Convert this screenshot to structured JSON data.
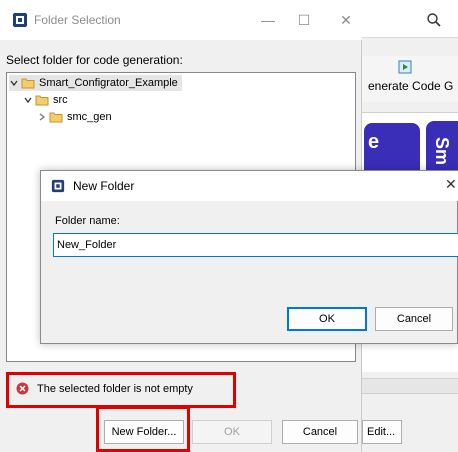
{
  "background_window": {
    "toolbar_label": "enerate Code  G",
    "block1_label": "e",
    "block2_label": "Sm",
    "edit_button": "Edit..."
  },
  "folder_dialog": {
    "title": "Folder Selection",
    "prompt": "Select folder for code generation:",
    "tree": [
      {
        "label": "Smart_Configrator_Example",
        "expanded": true,
        "selected": true,
        "depth": 0
      },
      {
        "label": "src",
        "expanded": true,
        "selected": false,
        "depth": 1
      },
      {
        "label": "smc_gen",
        "expanded": false,
        "selected": false,
        "depth": 2
      }
    ],
    "status_message": "The selected folder is not empty",
    "buttons": {
      "new_folder": "New Folder...",
      "ok": "OK",
      "cancel": "Cancel"
    }
  },
  "new_folder_dialog": {
    "title": "New Folder",
    "field_label": "Folder name:",
    "field_value": "New_Folder",
    "buttons": {
      "ok": "OK",
      "cancel": "Cancel"
    }
  },
  "colors": {
    "highlight": "#e00000",
    "accent": "#0078d7",
    "block": "#3a2db8",
    "folder": "#e8b84a",
    "error": "#d13438"
  },
  "icons": [
    "app-icon",
    "minimize-icon",
    "maximize-icon",
    "close-icon",
    "chevron-down-icon",
    "chevron-right-icon",
    "folder-icon",
    "error-icon",
    "search-icon",
    "generate-code-icon"
  ]
}
